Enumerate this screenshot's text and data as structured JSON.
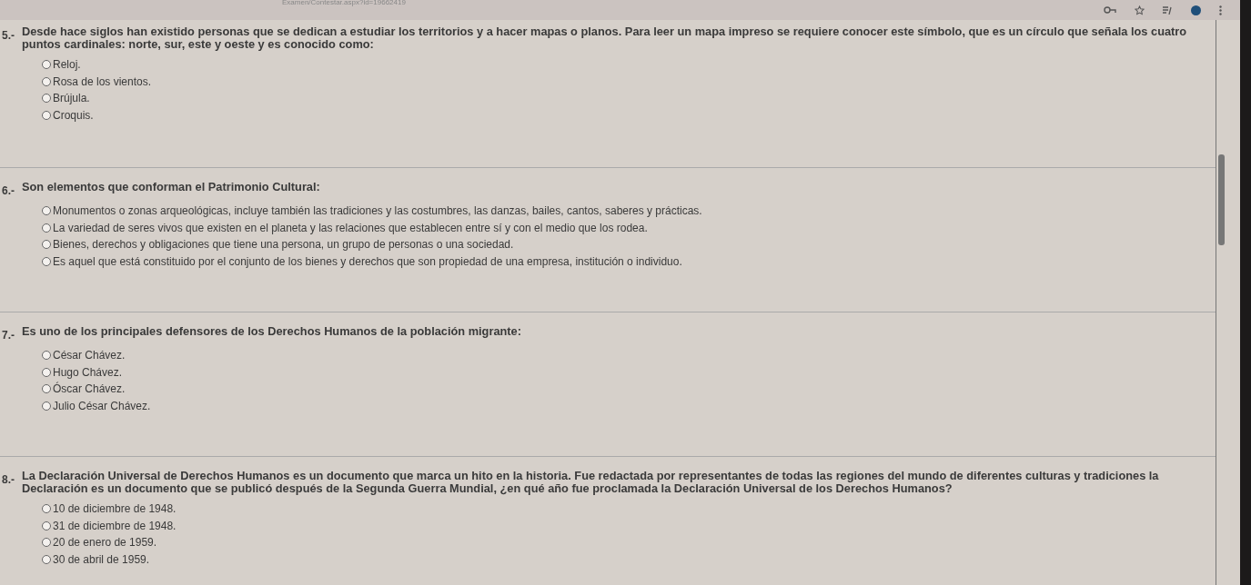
{
  "browser": {
    "url": "Examen/Contestar.aspx?id=19662419"
  },
  "questions": [
    {
      "number": "5.-",
      "text": "Desde hace siglos han existido personas que se dedican a estudiar los territorios y a hacer mapas o planos. Para leer un mapa impreso se requiere conocer este símbolo, que es un círculo que señala los cuatro puntos cardinales: norte, sur, este y oeste y es conocido como:",
      "options": [
        {
          "label": "Reloj.",
          "selected": false
        },
        {
          "label": "Rosa de los vientos.",
          "selected": false
        },
        {
          "label": "Brújula.",
          "selected": false
        },
        {
          "label": "Croquis.",
          "selected": false
        }
      ]
    },
    {
      "number": "6.-",
      "text": "Son elementos que conforman el Patrimonio Cultural:",
      "options": [
        {
          "label": "Monumentos o zonas arqueológicas, incluye también las tradiciones y las costumbres, las danzas, bailes, cantos, saberes y prácticas.",
          "selected": false
        },
        {
          "label": "La variedad de seres vivos que existen en el planeta y las relaciones que establecen entre sí y con el medio que los rodea.",
          "selected": false
        },
        {
          "label": "Bienes, derechos y obligaciones que tiene una persona, un grupo de personas o una sociedad.",
          "selected": false
        },
        {
          "label": "Es aquel que está constituido por el conjunto de los bienes y derechos que son propiedad de una empresa, institución o individuo.",
          "selected": false
        }
      ]
    },
    {
      "number": "7.-",
      "text": "Es uno de los principales defensores de los Derechos Humanos de la población migrante:",
      "options": [
        {
          "label": "César Chávez.",
          "selected": false
        },
        {
          "label": "Hugo Chávez.",
          "selected": false
        },
        {
          "label": "Óscar Chávez.",
          "selected": false
        },
        {
          "label": "Julio César Chávez.",
          "selected": false
        }
      ]
    },
    {
      "number": "8.-",
      "text": "La Declaración Universal de Derechos Humanos es un documento que marca un hito en la historia. Fue redactada por representantes de todas las regiones del mundo de diferentes culturas y tradiciones la Declaración es un documento que se publicó después de la Segunda Guerra Mundial, ¿en qué año fue proclamada la Declaración Universal de los Derechos Humanos?",
      "options": [
        {
          "label": "10 de diciembre de 1948.",
          "selected": false
        },
        {
          "label": "31 de diciembre de 1948.",
          "selected": false
        },
        {
          "label": "20 de enero de 1959.",
          "selected": false
        },
        {
          "label": "30 de abril de 1959.",
          "selected": false
        }
      ]
    }
  ]
}
